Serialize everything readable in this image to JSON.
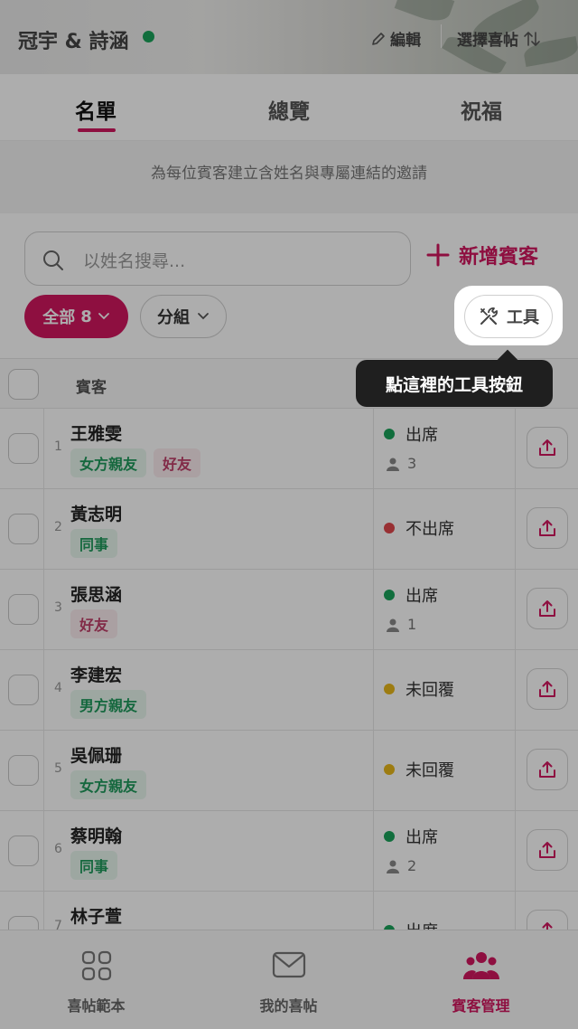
{
  "header": {
    "couple": "冠宇 & 詩涵",
    "edit_label": "編輯",
    "select_label": "選擇喜帖"
  },
  "tabs": [
    "名單",
    "總覽",
    "祝福"
  ],
  "banner": "為每位賓客建立含姓名與專屬連結的邀請",
  "search": {
    "placeholder": "以姓名搜尋..."
  },
  "add_guest_label": "新增賓客",
  "filters": {
    "all_label": "全部",
    "all_count": "8",
    "group_label": "分組",
    "tools_label": "工具"
  },
  "table": {
    "header_label": "賓客"
  },
  "guests": [
    {
      "num": "1",
      "name": "王雅雯",
      "tags": [
        {
          "text": "女方親友",
          "color": "green"
        },
        {
          "text": "好友",
          "color": "red"
        }
      ],
      "status": "出席",
      "status_color": "#1aa35a",
      "count": "3"
    },
    {
      "num": "2",
      "name": "黃志明",
      "tags": [
        {
          "text": "同事",
          "color": "green"
        }
      ],
      "status": "不出席",
      "status_color": "#e0474c",
      "count": ""
    },
    {
      "num": "3",
      "name": "張思涵",
      "tags": [
        {
          "text": "好友",
          "color": "red"
        }
      ],
      "status": "出席",
      "status_color": "#1aa35a",
      "count": "1"
    },
    {
      "num": "4",
      "name": "李建宏",
      "tags": [
        {
          "text": "男方親友",
          "color": "green"
        }
      ],
      "status": "未回覆",
      "status_color": "#e8b71a",
      "count": ""
    },
    {
      "num": "5",
      "name": "吳佩珊",
      "tags": [
        {
          "text": "女方親友",
          "color": "green"
        }
      ],
      "status": "未回覆",
      "status_color": "#e8b71a",
      "count": ""
    },
    {
      "num": "6",
      "name": "蔡明翰",
      "tags": [
        {
          "text": "同事",
          "color": "green"
        }
      ],
      "status": "出席",
      "status_color": "#1aa35a",
      "count": "2"
    },
    {
      "num": "7",
      "name": "林子萱",
      "tags": [],
      "status": "出席",
      "status_color": "#1aa35a",
      "count": ""
    }
  ],
  "tooltip": "點這裡的工具按鈕",
  "bottom_nav": [
    {
      "label": "喜帖範本",
      "icon": "grid-icon"
    },
    {
      "label": "我的喜帖",
      "icon": "envelope-icon"
    },
    {
      "label": "賓客管理",
      "icon": "people-icon"
    }
  ],
  "colors": {
    "accent": "#d1175f",
    "attending": "#1aa35a",
    "declined": "#e0474c",
    "pending": "#e8b71a"
  }
}
